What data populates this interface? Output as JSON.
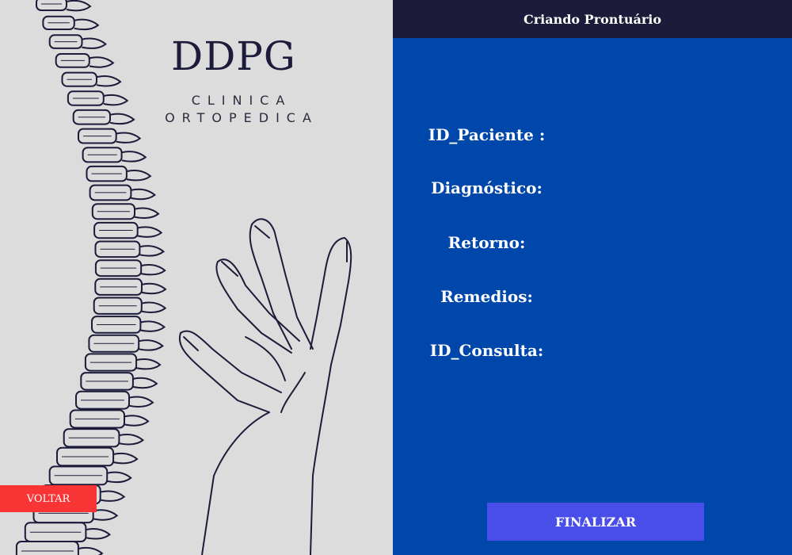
{
  "brand": {
    "name": "DDPG",
    "line1": "CLINICA",
    "line2": "ORTOPEDICA"
  },
  "left": {
    "back_button": "VOLTAR"
  },
  "form": {
    "title": "Criando Prontuário",
    "fields": [
      {
        "label": "ID_Paciente :"
      },
      {
        "label": "Diagnóstico:"
      },
      {
        "label": "Retorno:"
      },
      {
        "label": "Remedios:"
      },
      {
        "label": "ID_Consulta:"
      }
    ],
    "submit_label": "FINALIZAR"
  },
  "colors": {
    "left_background": "#dcdcdc",
    "right_background": "#0047ab",
    "header_background": "#1c1c3a",
    "back_button": "#f93434",
    "submit_button": "#4a4ee8",
    "illustration_ink": "#1c1c3a"
  },
  "icons": {
    "spine": "spine-illustration",
    "hand": "hand-illustration"
  }
}
